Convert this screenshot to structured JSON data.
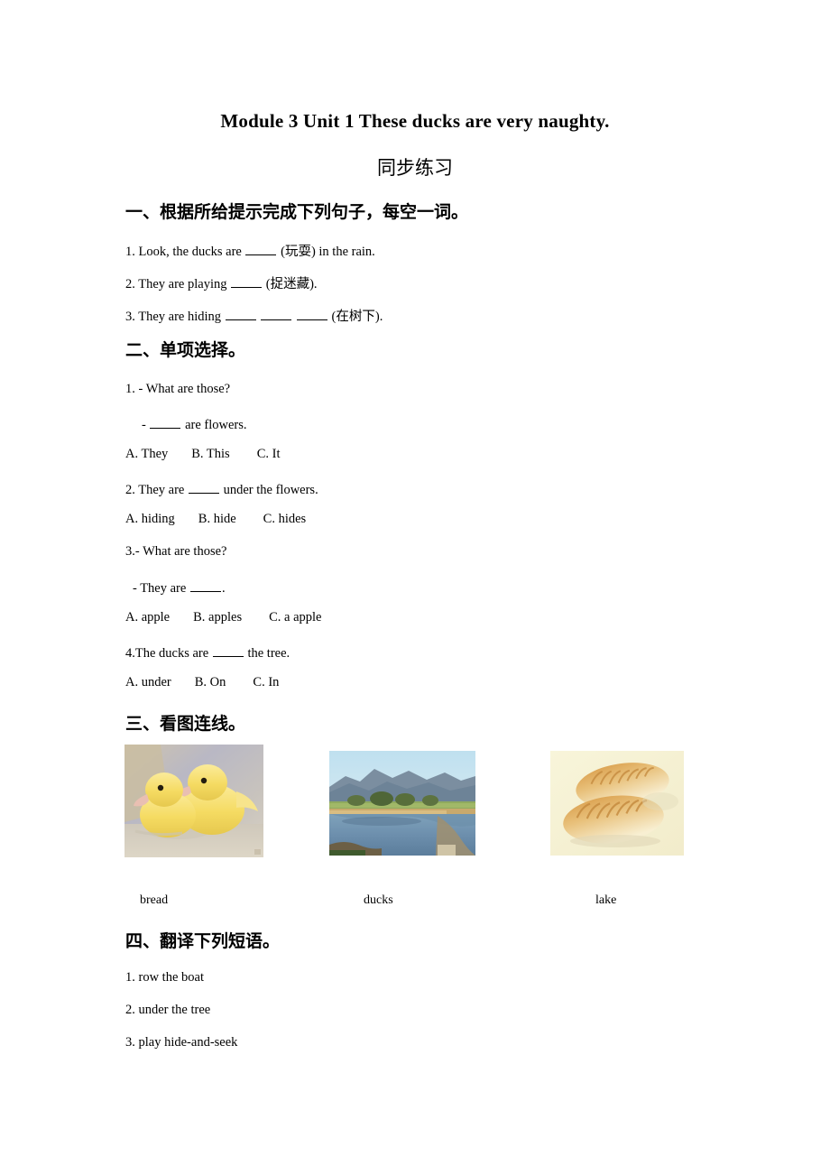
{
  "title": "Module 3 Unit 1 These ducks are very naughty.",
  "subtitle": "同步练习",
  "sections": {
    "one": {
      "heading": "一、根据所给提示完成下列句子，每空一词。",
      "q1_pre": "1. Look, the ducks are",
      "q1_post": "(玩耍) in the rain.",
      "q2_pre": "2. They are playing",
      "q2_post": "(捉迷藏).",
      "q3_pre": "3. They are hiding",
      "q3_post": "(在树下)."
    },
    "two": {
      "heading": "二、单项选择。",
      "q1_stem": "1. - What are those?",
      "q1_ans_pre": "-",
      "q1_ans_post": "are flowers.",
      "q1_a": "A. They",
      "q1_b": "B. This",
      "q1_c": "C. It",
      "q2_pre": "2. They are",
      "q2_post": "under the flowers.",
      "q2_a": "A. hiding",
      "q2_b": "B. hide",
      "q2_c": "C. hides",
      "q3_stem": "3.- What are those?",
      "q3_ans_pre": "- They are",
      "q3_ans_post": ".",
      "q3_a": "A. apple",
      "q3_b": "B. apples",
      "q3_c": "C. a apple",
      "q4_pre": "4.The ducks are",
      "q4_post": "the tree.",
      "q4_a": "A. under",
      "q4_b": "B. On",
      "q4_c": "C. In"
    },
    "three": {
      "heading": "三、看图连线。",
      "images": [
        {
          "name": "ducklings-photo",
          "alt": "two yellow ducklings"
        },
        {
          "name": "lake-photo",
          "alt": "lake with mountains"
        },
        {
          "name": "bread-photo",
          "alt": "two bread rolls"
        }
      ],
      "captions": [
        "bread",
        "ducks",
        "lake"
      ]
    },
    "four": {
      "heading": "四、翻译下列短语。",
      "items": [
        "1. row the boat",
        "2. under the tree",
        "3. play hide-and-seek"
      ]
    }
  },
  "colors": {
    "text": "#000000",
    "page_background": "#ffffff",
    "duck_yellow": "#f5dc6e",
    "lake_blue": "#6d95b4",
    "bread_crust": "#c98a3c",
    "bread_background": "#f7f3d8"
  }
}
